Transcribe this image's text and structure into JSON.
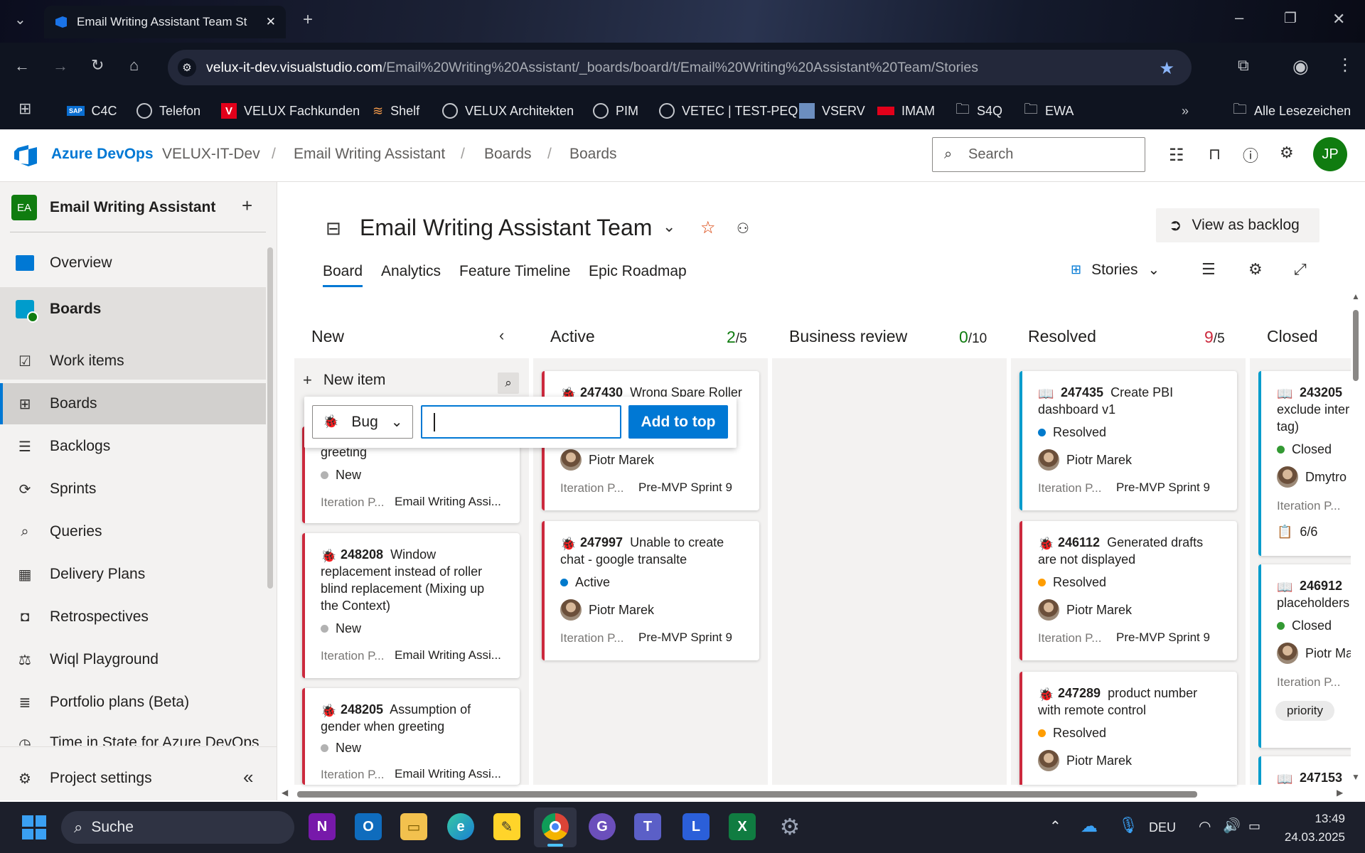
{
  "browser": {
    "tab_title": "Email Writing Assistant Team St",
    "url_host": "velux-it-dev.visualstudio.com",
    "url_path": "/Email%20Writing%20Assistant/_boards/board/t/Email%20Writing%20Assistant%20Team/Stories",
    "bookmarks": [
      "C4C",
      "Telefon",
      "VELUX Fachkunden",
      "Shelf",
      "VELUX Architekten",
      "PIM",
      "VETEC | TEST-PEQ",
      "VSERV",
      "IMAM",
      "S4Q",
      "EWA"
    ],
    "all_bookmarks": "Alle Lesezeichen"
  },
  "header": {
    "brand": "Azure DevOps",
    "crumbs": [
      "VELUX-IT-Dev",
      "Email Writing Assistant",
      "Boards",
      "Boards"
    ],
    "search_placeholder": "Search",
    "avatar": "JP"
  },
  "sidebar": {
    "project_badge": "EA",
    "project_name": "Email Writing Assistant",
    "items": [
      {
        "label": "Overview"
      },
      {
        "label": "Boards"
      },
      {
        "label": "Work items"
      },
      {
        "label": "Boards"
      },
      {
        "label": "Backlogs"
      },
      {
        "label": "Sprints"
      },
      {
        "label": "Queries"
      },
      {
        "label": "Delivery Plans"
      },
      {
        "label": "Retrospectives"
      },
      {
        "label": "Wiql Playground"
      },
      {
        "label": "Portfolio plans (Beta)"
      },
      {
        "label": "Time in State for Azure DevOps"
      }
    ],
    "settings": "Project settings"
  },
  "board": {
    "team_title": "Email Writing Assistant Team",
    "view_backlog": "View as backlog",
    "tabs": [
      "Board",
      "Analytics",
      "Feature Timeline",
      "Epic Roadmap"
    ],
    "level": "Stories",
    "new_item": "New item",
    "quick_add": {
      "type": "Bug",
      "button": "Add to top"
    },
    "columns": [
      {
        "name": "New",
        "count": "",
        "limit": ""
      },
      {
        "name": "Active",
        "count": "2",
        "limit": "/5"
      },
      {
        "name": "Business review",
        "count": "0",
        "limit": "/10"
      },
      {
        "name": "Resolved",
        "count": "9",
        "limit": "/5"
      },
      {
        "name": "Closed",
        "count": "",
        "limit": ""
      }
    ],
    "iteration_label": "Iteration P...",
    "cards": {
      "new": [
        {
          "title_tail": "greeting",
          "state": "New",
          "iteration": "Email Writing Assi..."
        },
        {
          "id": "248208",
          "title": "Window replacement instead of roller blind replacement (Mixing up the Context)",
          "state": "New",
          "iteration": "Email Writing Assi..."
        },
        {
          "id": "248205",
          "title": "Assumption of gender when greeting",
          "state": "New",
          "iteration": "Email Writing Assi..."
        }
      ],
      "active": [
        {
          "id": "247430",
          "title": "Wrong Spare Roller",
          "assignee": "Piotr Marek",
          "iteration": "Pre-MVP Sprint 9"
        },
        {
          "id": "247997",
          "title": "Unable to create chat - google transalte",
          "state": "Active",
          "assignee": "Piotr Marek",
          "iteration": "Pre-MVP Sprint 9"
        }
      ],
      "resolved": [
        {
          "id": "247435",
          "title": "Create PBI dashboard v1",
          "state": "Resolved",
          "assignee": "Piotr Marek",
          "iteration": "Pre-MVP Sprint 9"
        },
        {
          "id": "246112",
          "title": "Generated drafts are not displayed",
          "state": "Resolved",
          "assignee": "Piotr Marek",
          "iteration": "Pre-MVP Sprint 9"
        },
        {
          "id": "247289",
          "title": "product number with remote control",
          "state": "Resolved",
          "assignee": "Piotr Marek"
        }
      ],
      "closed": [
        {
          "id": "243205",
          "title": "exclude inter tag)",
          "state": "Closed",
          "assignee": "Dmytro",
          "tasks": "6/6"
        },
        {
          "id": "246912",
          "title": "placeholders",
          "state": "Closed",
          "assignee": "Piotr Ma",
          "tag": "priority"
        },
        {
          "id": "247153"
        }
      ]
    }
  },
  "taskbar": {
    "search": "Suche",
    "lang": "DEU",
    "time": "13:49",
    "date": "24.03.2025"
  },
  "colors": {
    "accent": "#0078d4",
    "bug": "#cc293d",
    "story": "#009ccc",
    "resolved_dot": "#ff9d00",
    "active_dot": "#007acc",
    "closed_dot": "#339933",
    "new_dot": "#b2b2b2"
  }
}
